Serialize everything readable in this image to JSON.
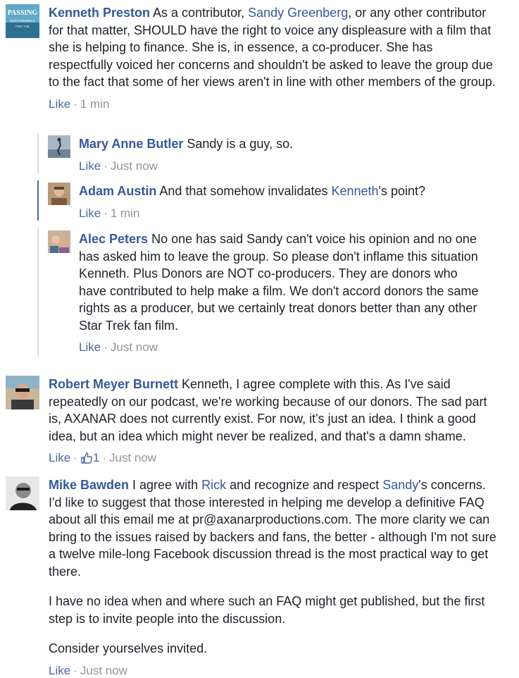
{
  "comments": [
    {
      "author": "Kenneth Preston",
      "avatar_text": [
        "PASSING",
        "EACH RESPECT",
        "FOR THE"
      ],
      "text_a": " As a contributor, ",
      "mention_a": "Sandy Greenberg",
      "text_b": ", or any other contributor for that matter, SHOULD have the right to voice any displeasure with a film that she is helping to finance. She is, in essence, a co-producer. She has respectfully voiced her concerns and shouldn't be asked to leave the group due to the fact that some of her views aren't in line with other members of the group.",
      "like": "Like",
      "time": "1 min"
    },
    {
      "author": "Mary Anne Butler",
      "text": " Sandy is a guy, so.",
      "like": "Like",
      "time": "Just now"
    },
    {
      "author": "Adam Austin",
      "text_a": " And that somehow invalidates ",
      "mention_a": "Kenneth",
      "text_b": "'s point?",
      "like": "Like",
      "time": "1 min"
    },
    {
      "author": "Alec Peters",
      "text": " No one has said Sandy can't voice his opinion and no one has asked him to leave the group. So please don't inflame this situation Kenneth. Plus Donors are NOT co-producers. They are donors who have contributed to help make a film. We don't accord donors the same rights as a producer, but we certainly treat donors better than any other Star Trek fan film.",
      "like": "Like",
      "time": "Just now"
    },
    {
      "author": "Robert Meyer Burnett",
      "text": " Kenneth, I agree complete with this. As I've said repeatedly on our podcast, we're working because of our donors. The sad part is, AXANAR does not currently exist. For now, it's just an idea. I think a good idea, but an idea which might never be realized, and that's a damn shame.",
      "like": "Like",
      "reactions": "1",
      "time": "Just now"
    },
    {
      "author": "Mike Bawden",
      "text_a": " I agree with ",
      "mention_a": "Rick",
      "text_b": " and recognize and respect ",
      "mention_b": "Sandy",
      "text_c": "'s concerns. I'd like to suggest that those interested in helping me develop a definitive FAQ about all this email me at pr@axanarproductions.com. The more clarity we can bring to the issues raised by backers and fans, the better - although I'm not sure a twelve mile-long Facebook discussion thread is the most practical way to get there.",
      "para2": "I have no idea when and where such an FAQ might get published, but the first step is to invite people into the discussion.",
      "para3": "Consider yourselves invited.",
      "like": "Like",
      "time": "Just now"
    }
  ],
  "separator": "·",
  "colors": {
    "link": "#365899",
    "like": "#4b67a1",
    "meta": "#90949c",
    "text": "#1d2129",
    "reply_rule": "#dcdee3",
    "reply_rule_active": "#4b67a1"
  }
}
